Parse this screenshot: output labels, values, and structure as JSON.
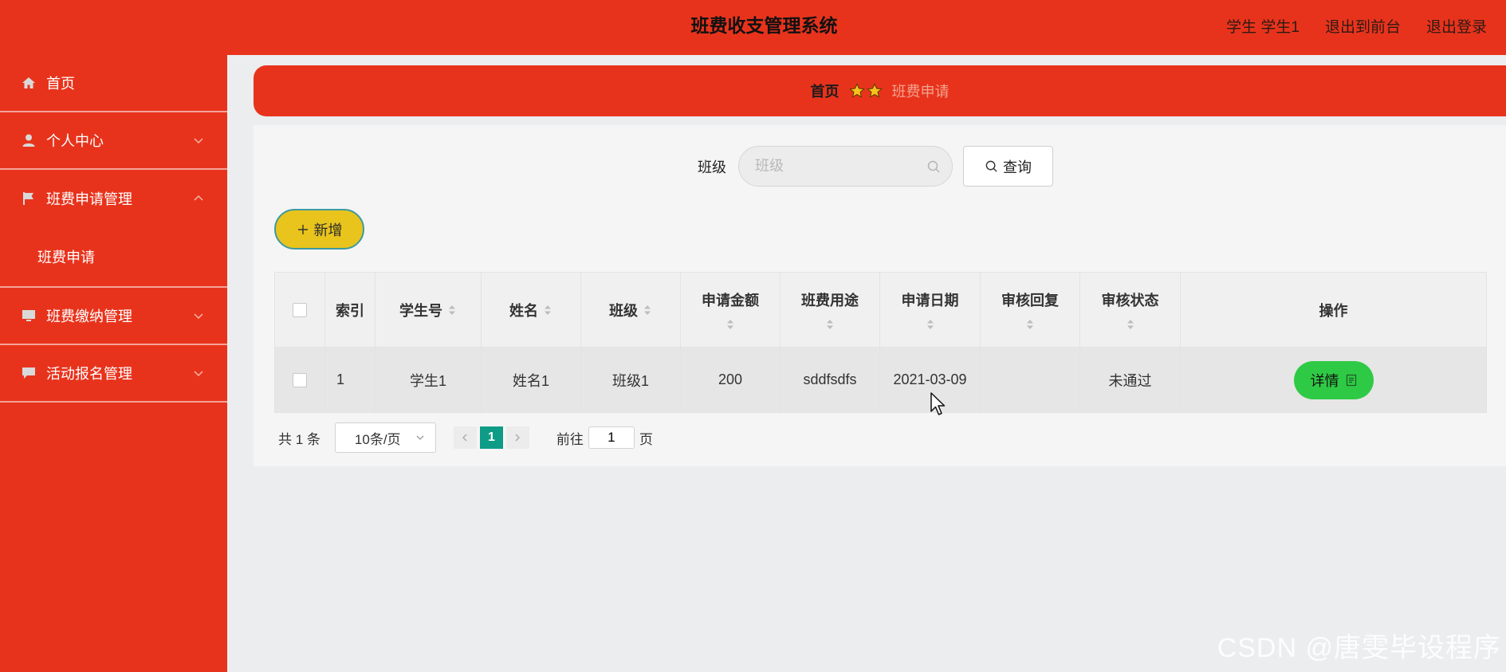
{
  "header": {
    "title": "班费收支管理系统",
    "user": "学生 学生1",
    "to_front": "退出到前台",
    "logout": "退出登录"
  },
  "sidebar": {
    "items": [
      {
        "label": "首页",
        "icon": "home-icon"
      },
      {
        "label": "个人中心",
        "icon": "user-icon",
        "chevron": "down"
      },
      {
        "label": "班费申请管理",
        "icon": "flag-icon",
        "chevron": "up",
        "expanded": true,
        "children": [
          {
            "label": "班费申请"
          }
        ]
      },
      {
        "label": "班费缴纳管理",
        "icon": "monitor-icon",
        "chevron": "down"
      },
      {
        "label": "活动报名管理",
        "icon": "chat-icon",
        "chevron": "down"
      }
    ]
  },
  "breadcrumb": {
    "home": "首页",
    "current": "班费申请"
  },
  "search": {
    "label": "班级",
    "placeholder": "班级",
    "button": "查询"
  },
  "actions": {
    "add": "新增"
  },
  "table": {
    "columns": [
      "索引",
      "学生号",
      "姓名",
      "班级",
      "申请金额",
      "班费用途",
      "申请日期",
      "审核回复",
      "审核状态",
      "操作"
    ],
    "rows": [
      {
        "index": "1",
        "student_no": "学生1",
        "name": "姓名1",
        "class": "班级1",
        "amount": "200",
        "purpose": "sddfsdfs",
        "date": "2021-03-09",
        "reply": "",
        "status": "未通过",
        "action": "详情"
      }
    ]
  },
  "pagination": {
    "total": "共 1 条",
    "page_size": "10条/页",
    "current_page": "1",
    "goto_prefix": "前往",
    "goto_value": "1",
    "goto_suffix": "页"
  },
  "watermark": "CSDN @唐雯毕设程序",
  "colors": {
    "primary_red": "#e8331c",
    "add_yellow": "#e8c41d",
    "detail_green": "#2fca45",
    "page_teal": "#0e9c86"
  }
}
